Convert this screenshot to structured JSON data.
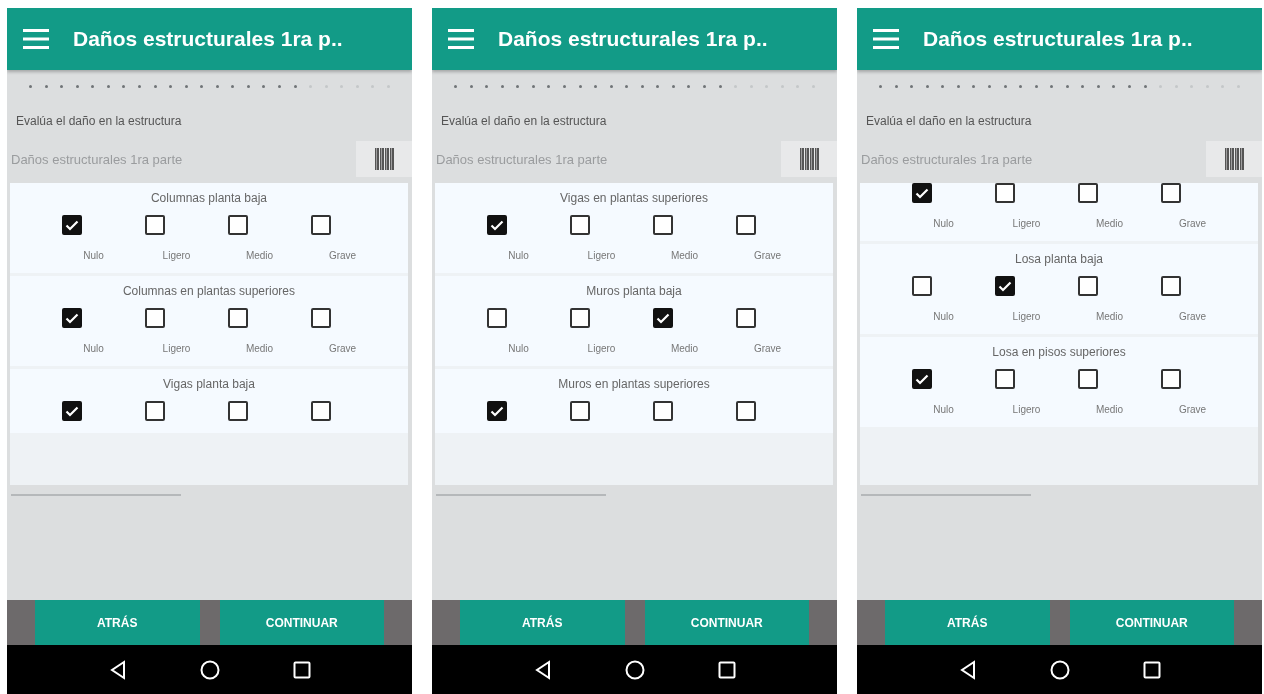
{
  "screens": [
    {
      "title": "Daños estructurales 1ra p..",
      "progress": {
        "level": 0.75
      },
      "prompt": "Evalúa el daño en la estructura",
      "field": {
        "value": "Daños estructurales 1ra parte"
      },
      "cards": [
        {
          "title": "Columnas planta baja",
          "options": [
            {
              "label": "Nulo",
              "checked": true
            },
            {
              "label": "Ligero",
              "checked": false
            },
            {
              "label": "Medio",
              "checked": false
            },
            {
              "label": "Grave",
              "checked": false
            }
          ]
        },
        {
          "title": "Columnas en plantas superiores",
          "options": [
            {
              "label": "Nulo",
              "checked": true
            },
            {
              "label": "Ligero",
              "checked": false
            },
            {
              "label": "Medio",
              "checked": false
            },
            {
              "label": "Grave",
              "checked": false
            }
          ]
        },
        {
          "title": "Vigas planta baja",
          "options": [
            {
              "checked": true
            },
            {
              "checked": false
            },
            {
              "checked": false
            },
            {
              "checked": false
            }
          ]
        }
      ],
      "buttons": [
        "ATRÁS",
        "CONTINUAR"
      ]
    },
    {
      "title": "Daños estructurales 1ra p..",
      "progress": {
        "level": 0.75
      },
      "prompt": "Evalúa el daño en la estructura",
      "field": {
        "value": "Daños estructurales 1ra parte"
      },
      "cards": [
        {
          "title": "Vigas en plantas superiores",
          "options": [
            {
              "label": "Nulo",
              "checked": true
            },
            {
              "label": "Ligero",
              "checked": false
            },
            {
              "label": "Medio",
              "checked": false
            },
            {
              "label": "Grave",
              "checked": false
            }
          ]
        },
        {
          "title": "Muros planta baja",
          "options": [
            {
              "label": "Nulo",
              "checked": false
            },
            {
              "label": "Ligero",
              "checked": false
            },
            {
              "label": "Medio",
              "checked": true
            },
            {
              "label": "Grave",
              "checked": false
            }
          ]
        },
        {
          "title": "Muros en plantas superiores",
          "options": [
            {
              "checked": true
            },
            {
              "checked": false
            },
            {
              "checked": false
            },
            {
              "checked": false
            }
          ]
        }
      ],
      "buttons": [
        "ATRÁS",
        "CONTINUAR"
      ]
    },
    {
      "title": "Daños estructurales 1ra p..",
      "progress": {
        "level": 0.75
      },
      "prompt": "Evalúa el daño en la estructura",
      "field": {
        "value": "Daños estructurales 1ra parte"
      },
      "cards": [
        {
          "options": [
            {
              "label": "Nulo",
              "checked": true
            },
            {
              "label": "Ligero",
              "checked": false
            },
            {
              "label": "Medio",
              "checked": false
            },
            {
              "label": "Grave",
              "checked": false
            }
          ]
        },
        {
          "title": "Losa planta baja",
          "options": [
            {
              "label": "Nulo",
              "checked": false
            },
            {
              "label": "Ligero",
              "checked": true
            },
            {
              "label": "Medio",
              "checked": false
            },
            {
              "label": "Grave",
              "checked": false
            }
          ]
        },
        {
          "title": "Losa en pisos superiores",
          "options": [
            {
              "label": "Nulo",
              "checked": true
            },
            {
              "label": "Ligero",
              "checked": false
            },
            {
              "label": "Medio",
              "checked": false
            },
            {
              "label": "Grave",
              "checked": false
            }
          ]
        }
      ],
      "buttons": [
        "ATRÁS",
        "CONTINUAR"
      ]
    }
  ]
}
